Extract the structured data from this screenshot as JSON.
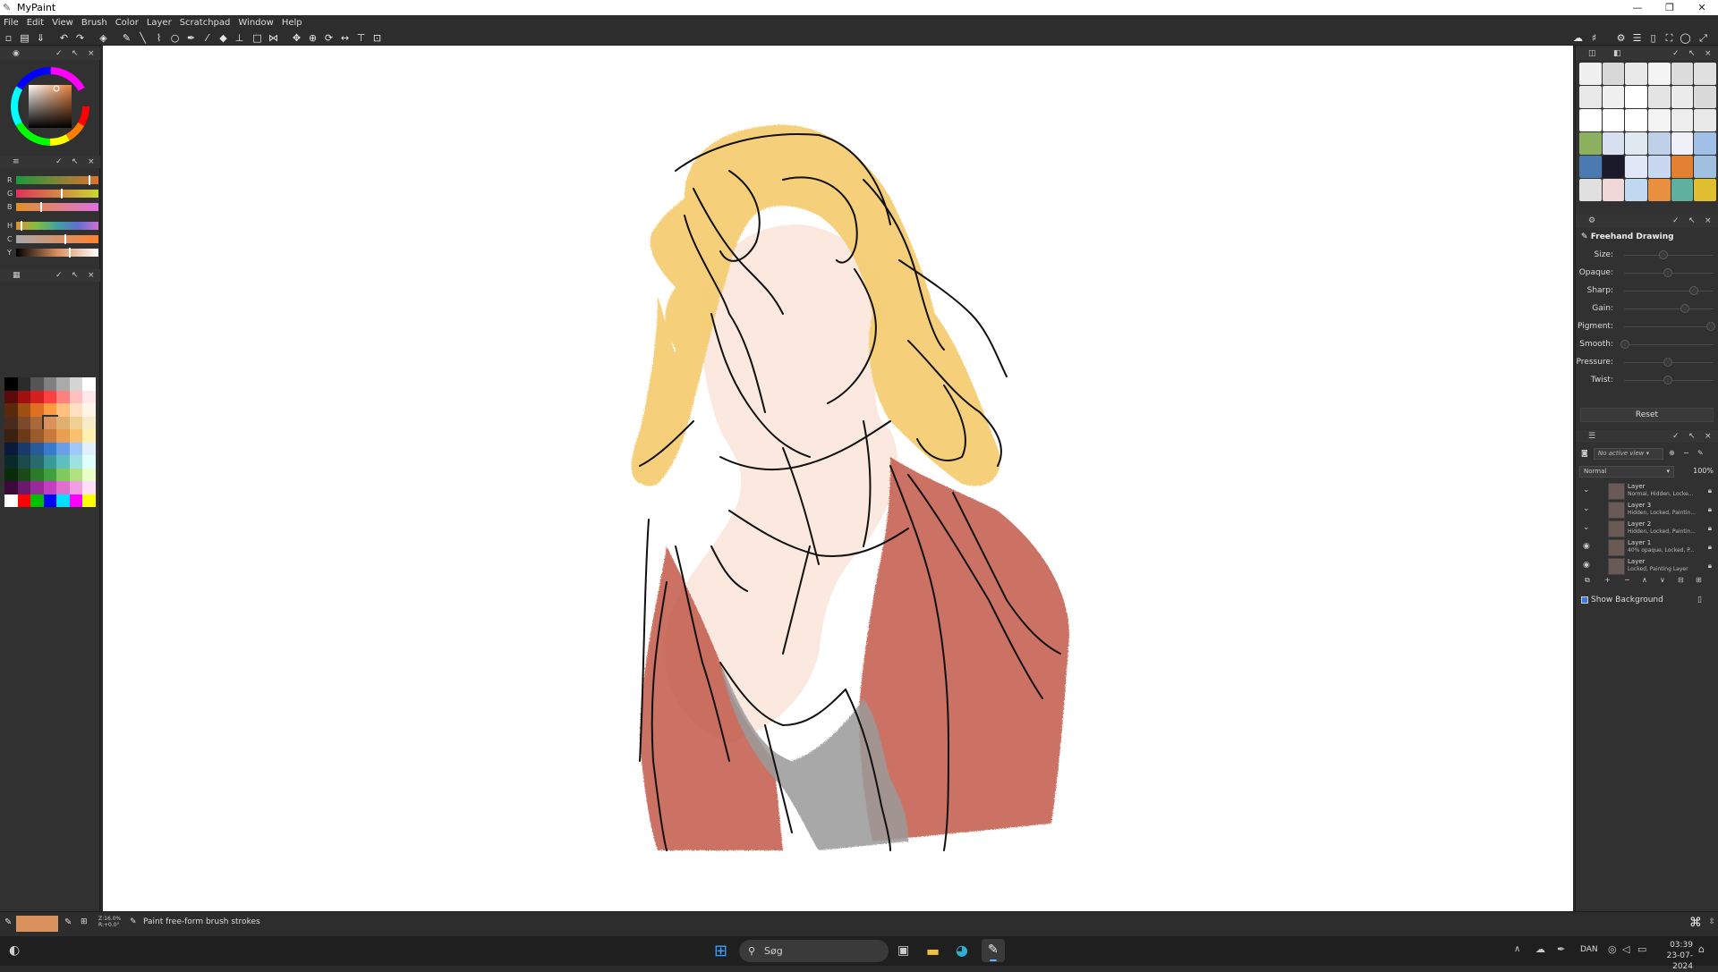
{
  "window": {
    "title": "MyPaint"
  },
  "window_controls": {
    "minimize": "—",
    "maximize": "❐",
    "close": "✕"
  },
  "menu": [
    "File",
    "Edit",
    "View",
    "Brush",
    "Color",
    "Layer",
    "Scratchpad",
    "Window",
    "Help"
  ],
  "color_sliders": [
    {
      "label": "R",
      "position": 0.9
    },
    {
      "label": "G",
      "position": 0.55
    },
    {
      "label": "B",
      "position": 0.3
    },
    {
      "label": "H",
      "position": 0.05
    },
    {
      "label": "C",
      "position": 0.6
    },
    {
      "label": "Y",
      "position": 0.65
    }
  ],
  "current_color": "#d9915e",
  "palette": [
    [
      "#000000",
      "#2b2b2b",
      "#555555",
      "#808080",
      "#aaaaaa",
      "#d4d4d4",
      "#ffffff"
    ],
    [
      "#5a0a0a",
      "#a01010",
      "#d42020",
      "#ff4040",
      "#ff8080",
      "#ffc0c0",
      "#ffe8e8"
    ],
    [
      "#5a2a0a",
      "#a05010",
      "#e07020",
      "#ff9a40",
      "#ffc080",
      "#ffe0c0",
      "#fff4e8"
    ],
    [
      "#4a2a1a",
      "#7a4a2a",
      "#a86a3a",
      "#d9915e",
      "#e0b070",
      "#f0d090",
      "#f8ecc8"
    ],
    [
      "#3a2010",
      "#6a3a1a",
      "#9a5a2a",
      "#c87a3a",
      "#e8a050",
      "#f8c070",
      "#fff0b0"
    ],
    [
      "#0a1a3a",
      "#1a3a6a",
      "#2a5a9a",
      "#3a7aca",
      "#6aa0e8",
      "#a0c8f8",
      "#e0f0ff"
    ],
    [
      "#0a2a2a",
      "#1a4a4a",
      "#2a6a6a",
      "#3a9a9a",
      "#60c0c0",
      "#a0e0e0",
      "#e0ffff"
    ],
    [
      "#0a2a0a",
      "#1a4a1a",
      "#2a7a2a",
      "#40a040",
      "#80c860",
      "#b0e080",
      "#e8ffc8"
    ],
    [
      "#3a0a3a",
      "#6a1a6a",
      "#9a2a9a",
      "#c040c0",
      "#e070d0",
      "#f0a0e0",
      "#ffe0f8"
    ],
    [
      "#ffffff",
      "#ff0000",
      "#00c000",
      "#0000ff",
      "#00e0ff",
      "#ff00ff",
      "#ffff00"
    ]
  ],
  "brush_props": {
    "title": "Freehand Drawing",
    "items": [
      {
        "label": "Size:",
        "value": 0.45
      },
      {
        "label": "Opaque:",
        "value": 0.5
      },
      {
        "label": "Sharp:",
        "value": 0.8
      },
      {
        "label": "Gain:",
        "value": 0.7
      },
      {
        "label": "Pigment:",
        "value": 1.0
      },
      {
        "label": "Smooth:",
        "value": 0.0
      },
      {
        "label": "Pressure:",
        "value": 0.5
      },
      {
        "label": "Twist:",
        "value": 0.5
      }
    ],
    "reset": "Reset"
  },
  "layers_panel": {
    "view_select": "No active view",
    "blend_mode": "Normal",
    "opacity": "100%",
    "layers": [
      {
        "name": "Layer",
        "status": "Normal, Hidden, Locke...",
        "visible": false
      },
      {
        "name": "Layer 3",
        "status": "Hidden, Locked, Paintin...",
        "visible": false
      },
      {
        "name": "Layer 2",
        "status": "Hidden, Locked, Paintin...",
        "visible": false
      },
      {
        "name": "Layer 1",
        "status": "40% opaque, Locked, P...",
        "visible": true
      },
      {
        "name": "Layer",
        "status": "Locked, Painting Layer",
        "visible": true
      }
    ],
    "show_background": "Show Background"
  },
  "status": {
    "zoom_info": "Z:16.0%\nR:+0.0°",
    "message": "Paint free-form brush strokes"
  },
  "taskbar": {
    "search_placeholder": "Søg",
    "language": "DAN",
    "time": "03:39",
    "date": "23-07-2024"
  }
}
